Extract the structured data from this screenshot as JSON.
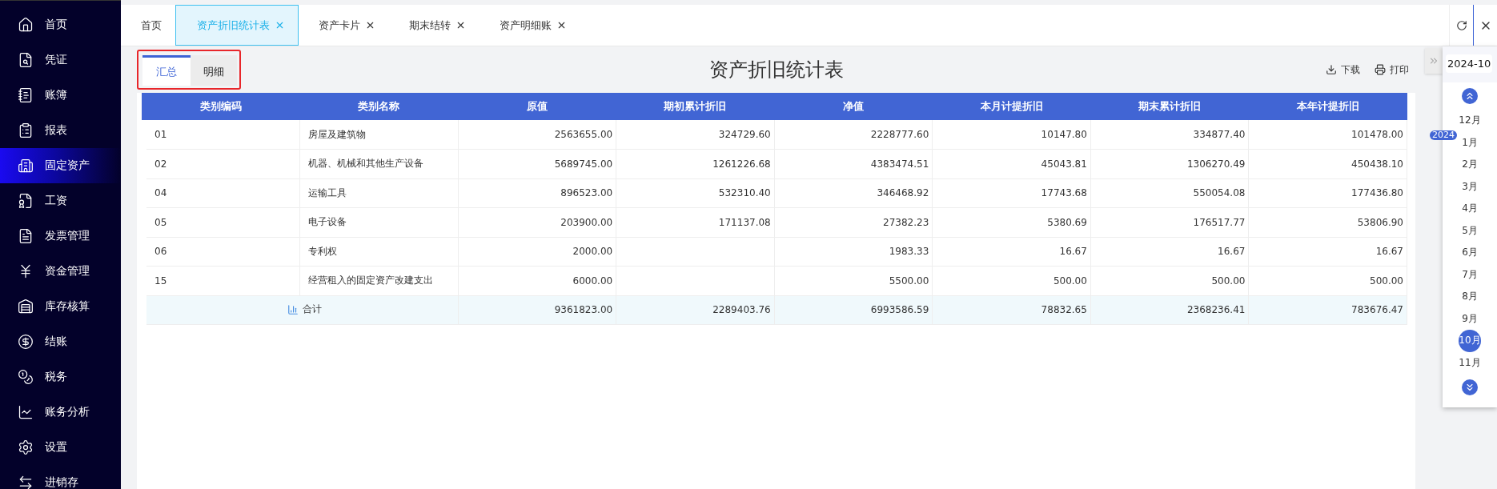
{
  "sidebar": {
    "items": [
      {
        "label": "首页",
        "selected": false
      },
      {
        "label": "凭证",
        "selected": false
      },
      {
        "label": "账簿",
        "selected": false
      },
      {
        "label": "报表",
        "selected": false
      },
      {
        "label": "固定资产",
        "selected": true
      },
      {
        "label": "工资",
        "selected": false
      },
      {
        "label": "发票管理",
        "selected": false
      },
      {
        "label": "资金管理",
        "selected": false
      },
      {
        "label": "库存核算",
        "selected": false
      },
      {
        "label": "结账",
        "selected": false
      },
      {
        "label": "税务",
        "selected": false
      },
      {
        "label": "账务分析",
        "selected": false
      },
      {
        "label": "设置",
        "selected": false
      },
      {
        "label": "进销存",
        "selected": false
      }
    ]
  },
  "top_tabs": [
    {
      "label": "首页",
      "selected": false,
      "closable": false
    },
    {
      "label": "资产折旧统计表",
      "selected": true,
      "closable": true
    },
    {
      "label": "资产卡片",
      "selected": false,
      "closable": true
    },
    {
      "label": "期末结转",
      "selected": false,
      "closable": true
    },
    {
      "label": "资产明细账",
      "selected": false,
      "closable": true
    }
  ],
  "sub_tabs": [
    {
      "label": "汇总",
      "selected": true
    },
    {
      "label": "明细",
      "selected": false
    }
  ],
  "report_title": "资产折旧统计表",
  "actions": [
    {
      "label": "下载",
      "kind": "download"
    },
    {
      "label": "打印",
      "kind": "print"
    }
  ],
  "table": {
    "columns": [
      "类别编码",
      "类别名称",
      "原值",
      "期初累计折旧",
      "净值",
      "本月计提折旧",
      "期末累计折旧",
      "本年计提折旧"
    ],
    "rows": [
      [
        "01",
        "房屋及建筑物",
        "2563655.00",
        "324729.60",
        "2228777.60",
        "10147.80",
        "334877.40",
        "101478.00"
      ],
      [
        "02",
        "机器、机械和其他生产设备",
        "5689745.00",
        "1261226.68",
        "4383474.51",
        "45043.81",
        "1306270.49",
        "450438.10"
      ],
      [
        "04",
        "运输工具",
        "896523.00",
        "532310.40",
        "346468.92",
        "17743.68",
        "550054.08",
        "177436.80"
      ],
      [
        "05",
        "电子设备",
        "203900.00",
        "171137.08",
        "27382.23",
        "5380.69",
        "176517.77",
        "53806.90"
      ],
      [
        "06",
        "专利权",
        "2000.00",
        "",
        "1983.33",
        "16.67",
        "16.67",
        "16.67"
      ],
      [
        "15",
        "经营租入的固定资产改建支出",
        "6000.00",
        "",
        "5500.00",
        "500.00",
        "500.00",
        "500.00"
      ]
    ],
    "total": {
      "label": "合计",
      "values": [
        "9361823.00",
        "2289403.76",
        "6993586.59",
        "78832.65",
        "2368236.41",
        "783676.47"
      ]
    }
  },
  "date_panel": {
    "value": "2024-10",
    "year": "2024",
    "months": [
      {
        "label": "12月",
        "selected": false
      },
      {
        "label": "1月",
        "selected": false
      },
      {
        "label": "2月",
        "selected": false
      },
      {
        "label": "3月",
        "selected": false
      },
      {
        "label": "4月",
        "selected": false
      },
      {
        "label": "5月",
        "selected": false
      },
      {
        "label": "6月",
        "selected": false
      },
      {
        "label": "7月",
        "selected": false
      },
      {
        "label": "8月",
        "selected": false
      },
      {
        "label": "9月",
        "selected": false
      },
      {
        "label": "10月",
        "selected": true
      },
      {
        "label": "11月",
        "selected": false
      }
    ]
  }
}
